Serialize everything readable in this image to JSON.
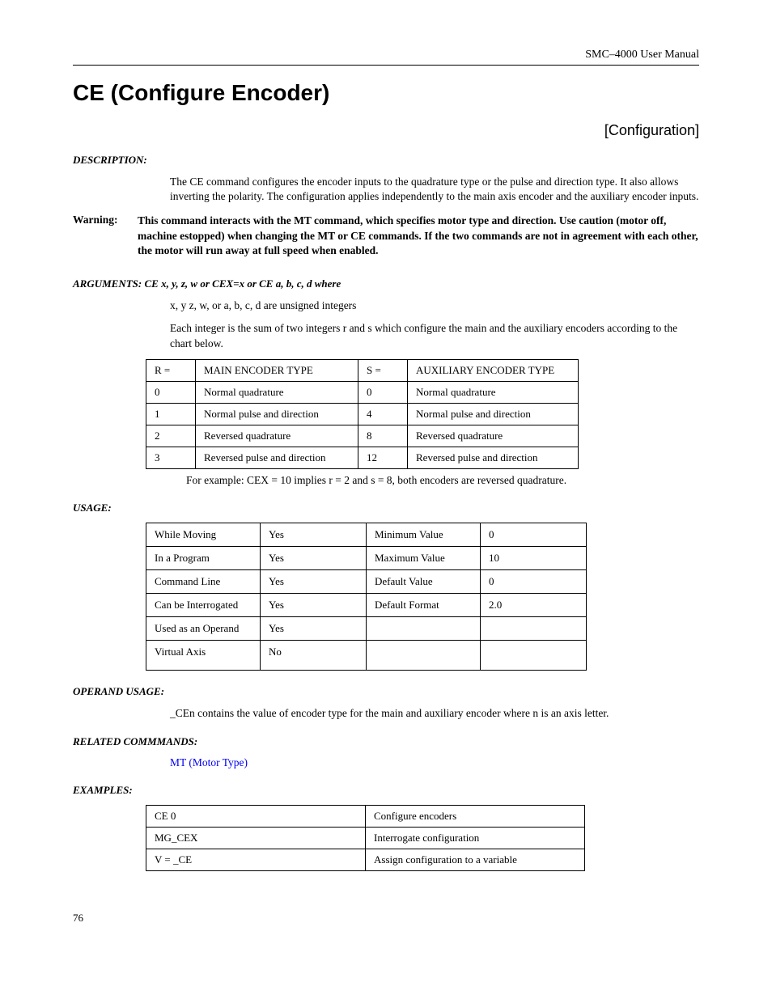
{
  "header": "SMC–4000 User Manual",
  "title": "CE (Configure Encoder)",
  "category": "[Configuration]",
  "description_label": "DESCRIPTION:",
  "description_text": "The CE command configures the encoder inputs to the quadrature type or the pulse and direction type. It also allows inverting the polarity. The configuration applies independently to the main axis encoder and the auxiliary encoder inputs.",
  "warning_label": "Warning:",
  "warning_text": "This command interacts with the MT command, which specifies motor type and direction. Use caution (motor off, machine estopped) when changing the MT or CE commands. If the two commands are not in agreement with each other, the motor will run away at full speed when enabled.",
  "arguments_label": "ARGUMENTS:  CE x, y, z, w or CEX=x or CE a, b, c, d    where",
  "arguments_text1": "x, y z, w, or a, b, c, d are unsigned integers",
  "arguments_text2": "Each integer is the sum of two integers r and s which configure the main and the auxiliary encoders according to the chart below.",
  "encoder_table": {
    "headers": [
      "R =",
      "MAIN ENCODER TYPE",
      "S =",
      "AUXILIARY ENCODER TYPE"
    ],
    "rows": [
      [
        "0",
        "Normal quadrature",
        "0",
        "Normal quadrature"
      ],
      [
        "1",
        "Normal pulse and direction",
        "4",
        "Normal pulse and direction"
      ],
      [
        "2",
        "Reversed quadrature",
        "8",
        "Reversed quadrature"
      ],
      [
        "3",
        "Reversed pulse and direction",
        "12",
        "Reversed pulse and direction"
      ]
    ]
  },
  "example_note": "For example:  CEX = 10 implies r = 2 and s = 8, both encoders are reversed quadrature.",
  "usage_label": "USAGE:",
  "usage_table": {
    "rows": [
      [
        "While Moving",
        "Yes",
        "Minimum Value",
        "0"
      ],
      [
        "In a Program",
        "Yes",
        "Maximum Value",
        "10"
      ],
      [
        "Command Line",
        "Yes",
        "Default Value",
        "0"
      ],
      [
        "Can be Interrogated",
        "Yes",
        "Default Format",
        "2.0"
      ],
      [
        "Used as an Operand",
        "Yes",
        "",
        ""
      ],
      [
        "Virtual Axis",
        "No",
        "",
        ""
      ]
    ]
  },
  "operand_label": "OPERAND USAGE:",
  "operand_text": "_CEn contains the value of encoder type for the main and auxiliary encoder where n is an axis letter.",
  "related_label": "RELATED COMMMANDS:",
  "related_link": "MT (Motor Type)",
  "examples_label": "EXAMPLES:",
  "examples_table": {
    "rows": [
      [
        "CE 0",
        "Configure encoders"
      ],
      [
        "MG_CEX",
        "Interrogate configuration"
      ],
      [
        "V = _CE",
        "Assign configuration to a variable"
      ]
    ]
  },
  "page_number": "76"
}
